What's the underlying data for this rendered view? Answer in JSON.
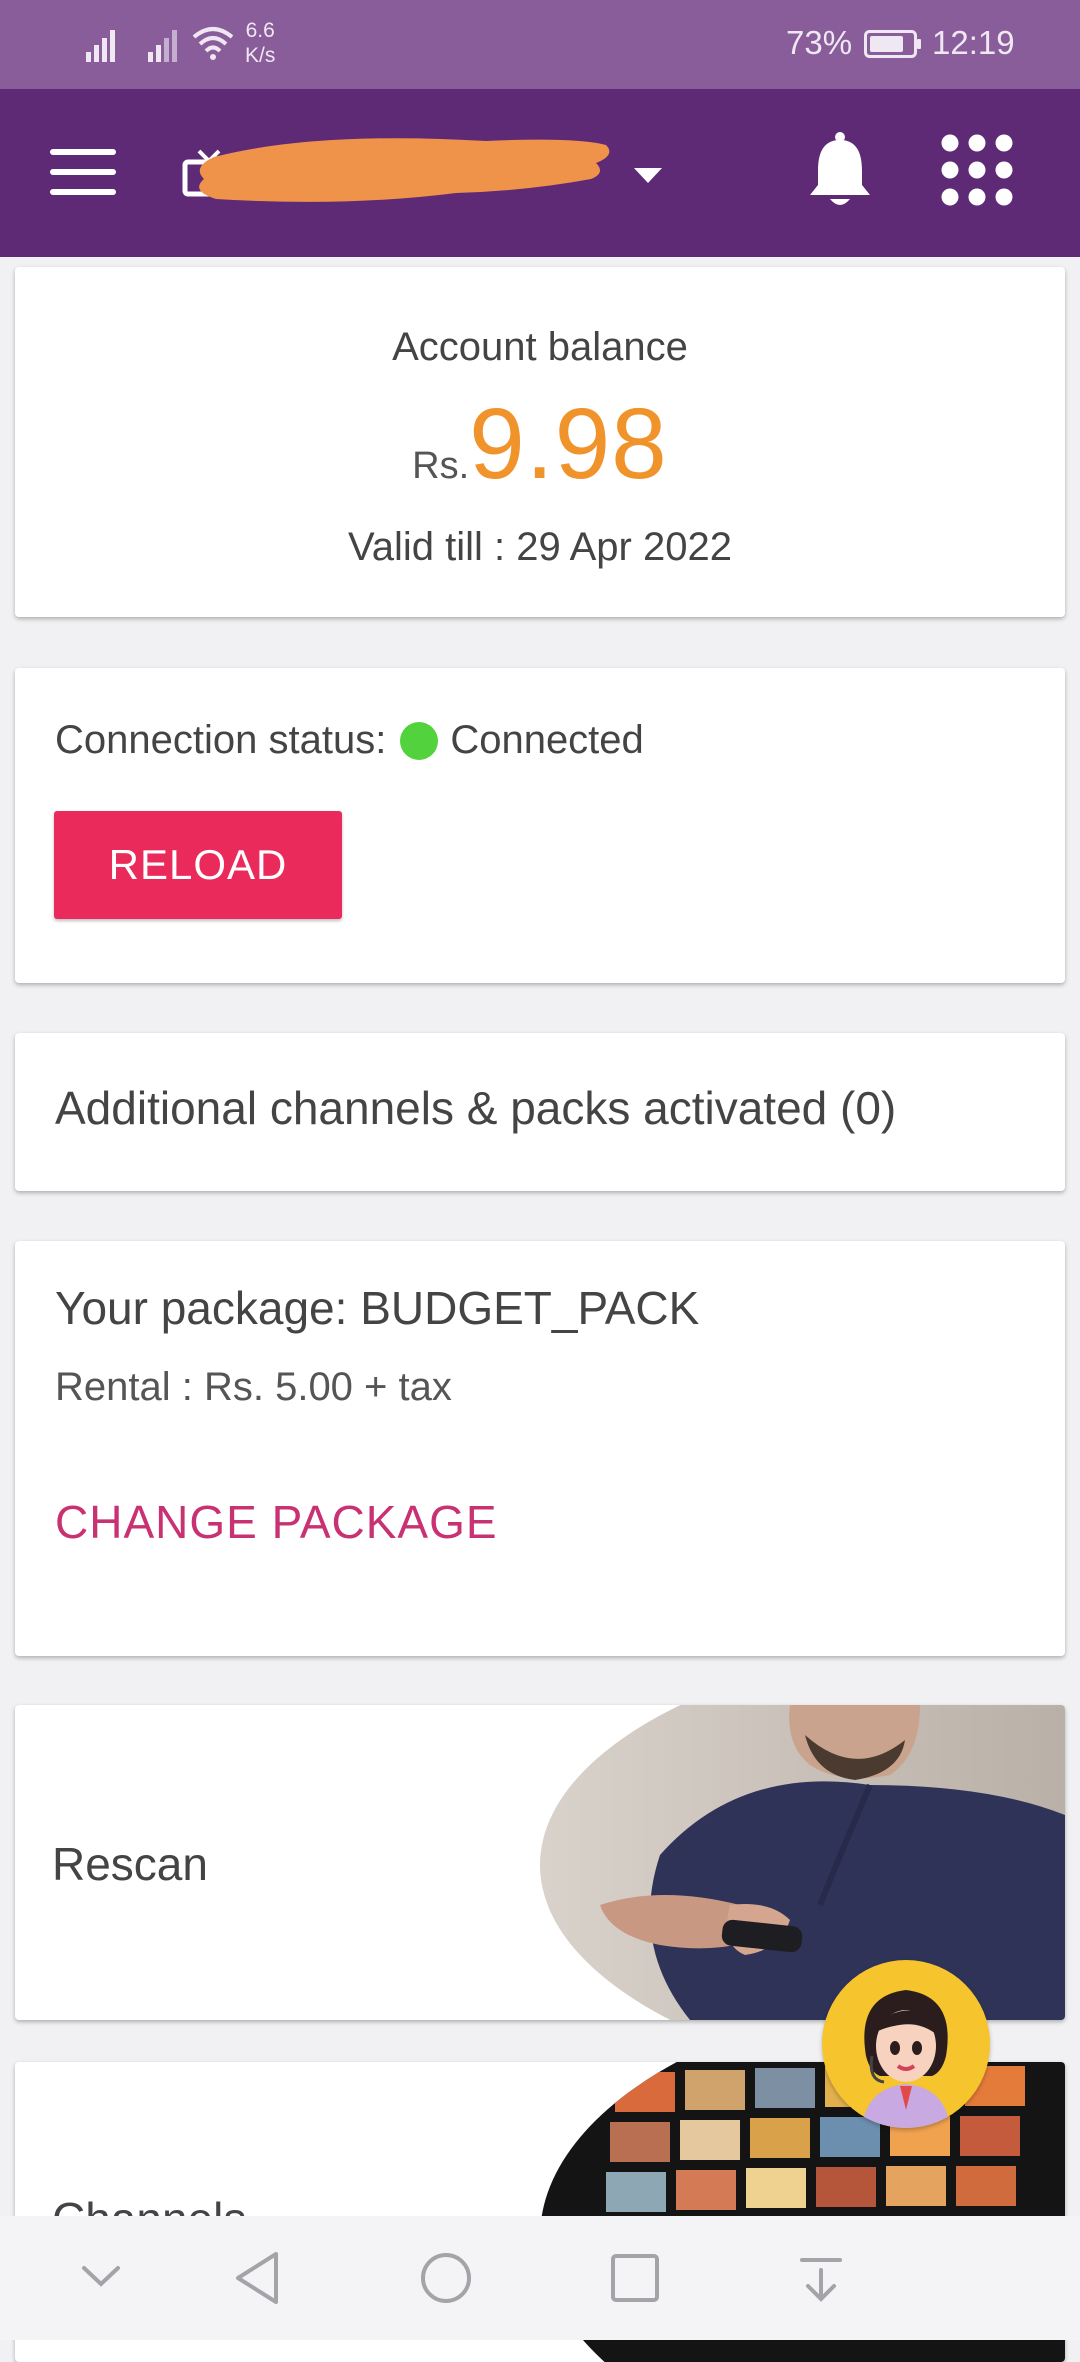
{
  "status_bar": {
    "net_speed_value": "6.6",
    "net_speed_unit": "K/s",
    "battery_percent": "73%",
    "time": "12:19"
  },
  "app_bar": {
    "account_name_redacted": true,
    "colors": {
      "app_bar": "#5e2a76",
      "status_bar": "#895d9a",
      "redaction": "#f0934a"
    }
  },
  "balance": {
    "title": "Account balance",
    "currency": "Rs.",
    "amount": "9.98",
    "validity": "Valid till : 29 Apr 2022",
    "amount_color": "#f0932b"
  },
  "connection": {
    "label": "Connection status:",
    "status": "Connected",
    "status_color": "#52d23c",
    "reload_label": "RELOAD",
    "reload_color": "#ea2a5b"
  },
  "addons": {
    "text": "Additional channels & packs activated (0)"
  },
  "package": {
    "name": "Your package: BUDGET_PACK",
    "rental": "Rental : Rs. 5.00 + tax",
    "change_label": "CHANGE PACKAGE",
    "change_color": "#c83272"
  },
  "tiles": {
    "rescan_label": "Rescan",
    "channels_label": "Channels"
  },
  "icons": [
    "menu-icon",
    "tv-icon",
    "dropdown-arrow-icon",
    "bell-icon",
    "apps-grid-icon",
    "assistant-avatar-icon",
    "nav-hide-icon",
    "nav-back-icon",
    "nav-home-icon",
    "nav-recents-icon",
    "nav-notifications-icon"
  ]
}
